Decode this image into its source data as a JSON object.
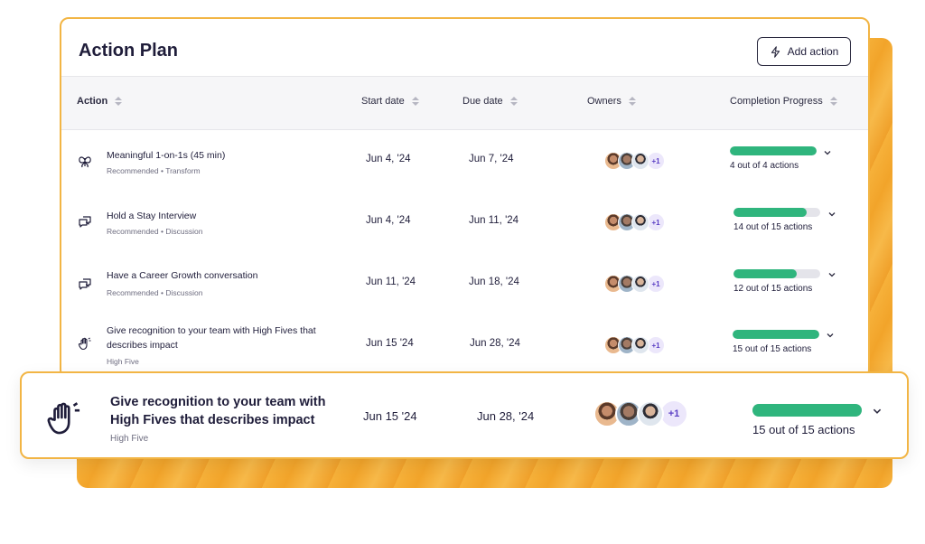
{
  "header": {
    "title": "Action Plan",
    "add_button_label": "Add action"
  },
  "columns": {
    "action": "Action",
    "start_date": "Start date",
    "due_date": "Due date",
    "owners": "Owners",
    "completion": "Completion Progress"
  },
  "rows": [
    {
      "icon": "butterfly-icon",
      "title": "Meaningful 1-on-1s (45 min)",
      "tag1": "Recommended",
      "tag2": "Transform",
      "start": "Jun 4, '24",
      "due": "Jun 7, '24",
      "extra_owners": "+1",
      "progress": 1.0,
      "progress_text": "4 out of 4 actions"
    },
    {
      "icon": "chat-bubbles-icon",
      "title": "Hold a Stay Interview",
      "tag1": "Recommended",
      "tag2": "Discussion",
      "start": "Jun 4, '24",
      "due": "Jun 11, '24",
      "extra_owners": "+1",
      "progress": 0.933,
      "progress_text": "14 out of 15 actions"
    },
    {
      "icon": "chat-bubbles-icon",
      "title": "Have a Career Growth conversation",
      "tag1": "Recommended",
      "tag2": "Discussion",
      "start": "Jun 11, '24",
      "due": "Jun 18, '24",
      "extra_owners": "+1",
      "progress": 0.8,
      "progress_text": "12 out of 15 actions"
    },
    {
      "icon": "high-five-icon",
      "title": "Give recognition to your team with High Fives that describes impact",
      "tag1": "High Five",
      "start": "Jun 15 '24",
      "due": "Jun 28, '24",
      "extra_owners": "+1",
      "progress": 1.0,
      "progress_text": "15 out of 15 actions"
    }
  ],
  "highlight": {
    "icon": "high-five-icon",
    "title": "Give recognition to your team with High Fives that describes impact",
    "tag": "High Five",
    "start": "Jun 15 '24",
    "due": "Jun 28, '24",
    "extra_owners": "+1",
    "progress": 1.0,
    "progress_text": "15 out of 15 actions"
  },
  "colors": {
    "accent_border": "#f2b544",
    "progress_fill": "#2fb57d",
    "plus_badge": "#5b3fc4"
  }
}
